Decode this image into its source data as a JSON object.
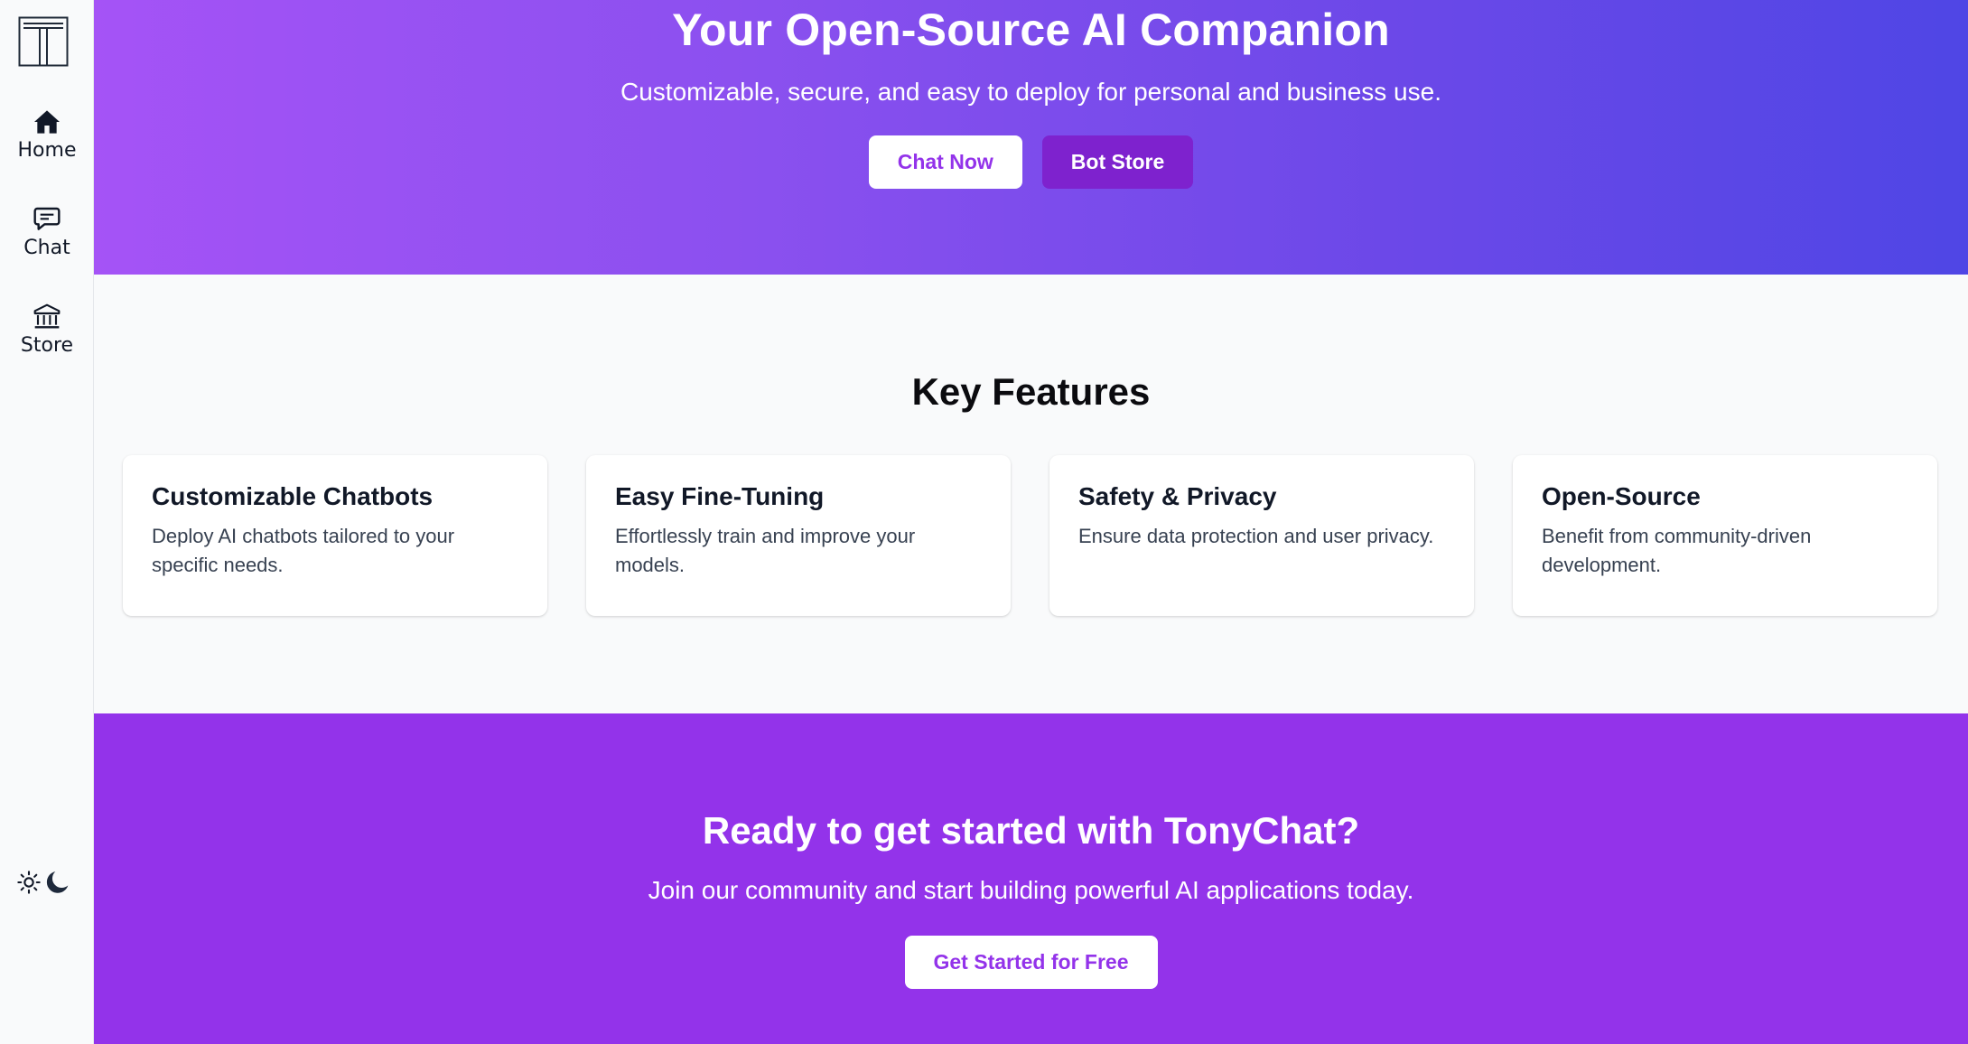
{
  "sidebar": {
    "logo_letter": "T",
    "nav": [
      {
        "label": "Home",
        "icon": "home-icon"
      },
      {
        "label": "Chat",
        "icon": "chat-icon"
      },
      {
        "label": "Store",
        "icon": "store-icon"
      }
    ],
    "theme_toggle": {
      "light_icon": "sun-icon",
      "dark_icon": "moon-icon"
    }
  },
  "hero": {
    "title": "Your Open-Source AI Companion",
    "subtitle": "Customizable, secure, and easy to deploy for personal and business use.",
    "primary_button": "Chat Now",
    "secondary_button": "Bot Store"
  },
  "features": {
    "title": "Key Features",
    "cards": [
      {
        "title": "Customizable Chatbots",
        "description": "Deploy AI chatbots tailored to your specific needs."
      },
      {
        "title": "Easy Fine-Tuning",
        "description": "Effortlessly train and improve your models."
      },
      {
        "title": "Safety & Privacy",
        "description": "Ensure data protection and user privacy."
      },
      {
        "title": "Open-Source",
        "description": "Benefit from community-driven development."
      }
    ]
  },
  "cta": {
    "title": "Ready to get started with TonyChat?",
    "subtitle": "Join our community and start building powerful AI applications today.",
    "button": "Get Started for Free"
  },
  "colors": {
    "hero_gradient_start": "#a553f6",
    "hero_gradient_end": "#4f46e5",
    "accent_purple": "#9333ea",
    "button_purple": "#7e22ce",
    "page_background": "#f9fafb"
  }
}
